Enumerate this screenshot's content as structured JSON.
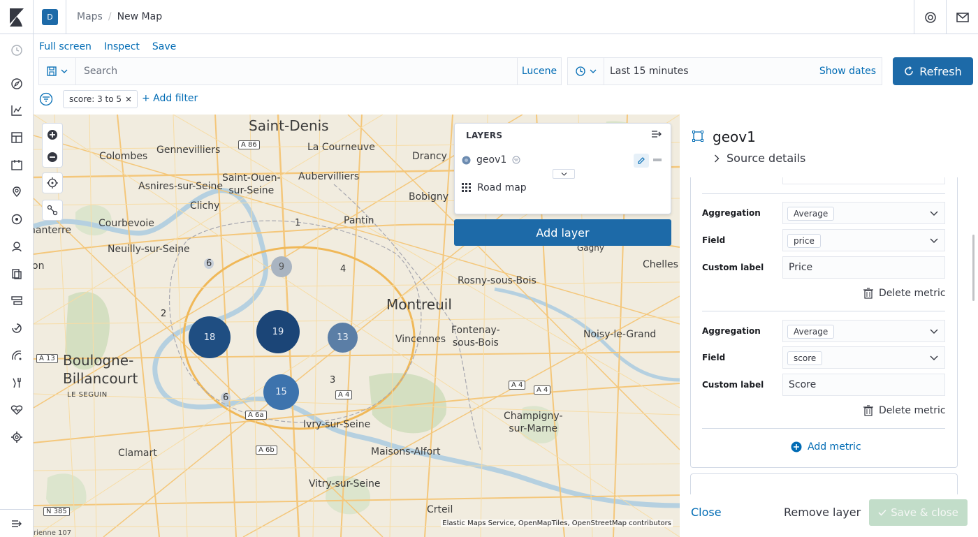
{
  "topnav": {
    "space_initial": "D",
    "breadcrumb": [
      "Maps",
      "New Map"
    ],
    "separator": "/"
  },
  "menu": [
    "Full screen",
    "Inspect",
    "Save"
  ],
  "query": {
    "placeholder": "Search",
    "language": "Lucene"
  },
  "time": {
    "range": "Last 15 minutes",
    "show_dates": "Show dates",
    "refresh": "Refresh"
  },
  "filters": {
    "pills": [
      "score: 3 to 5"
    ],
    "add": "+ Add filter"
  },
  "map": {
    "places": [
      "Saint-Denis",
      "La Courneuve",
      "Colombes",
      "Gennevilliers",
      "Drancy",
      "Saint-Ouen-\nsur-Seine",
      "Aubervilliers",
      "Asnires-sur-Seine",
      "Bobigny",
      "Clichy",
      "Pantin",
      "Courbevoie",
      "Neuilly-sur-Seine",
      "Rosny-sous-Bois",
      "Chelles",
      "Gagny",
      "Montreuil",
      "Fontenay-\nsous-Bois",
      "Vincennes",
      "Noisy-le-Grand",
      "Boulogne-\nBillancourt",
      "LE SEGUIN",
      "Ivry-sur-Seine",
      "Champigny-\nsur-Marne",
      "Clamart",
      "Maisons-Alfort",
      "Vitry-sur-Seine",
      "Crteil",
      "nanterre",
      "on",
      "rienne 107"
    ],
    "roads": [
      "A 86",
      "A 13",
      "A 4",
      "A 4",
      "A 4",
      "A 6a",
      "A 6b",
      "N 385"
    ],
    "clusters": [
      "18",
      "19",
      "13",
      "15",
      "9"
    ],
    "small_counts": [
      "1",
      "6",
      "4",
      "2",
      "3",
      "6"
    ],
    "attribution": "Elastic Maps Service, OpenMapTiles, OpenStreetMap contributors",
    "cluster_colors": {
      "dark": "#1f4e82",
      "mid": "#3d6a9c",
      "light": "#5b86b5",
      "grey": "#a9b4c1"
    }
  },
  "layers": {
    "title": "LAYERS",
    "items": [
      "geov1",
      "Road map"
    ],
    "add_layer": "Add layer"
  },
  "editor": {
    "title": "geov1",
    "source_details": "Source details",
    "metrics": [
      {
        "agg_label": "Aggregation",
        "agg": "Average",
        "field_label": "Field",
        "field": "price",
        "custom_label": "Custom label",
        "label_value": "Price",
        "delete": "Delete metric"
      },
      {
        "agg_label": "Aggregation",
        "agg": "Average",
        "field_label": "Field",
        "field": "score",
        "custom_label": "Custom label",
        "label_value": "Score",
        "delete": "Delete metric"
      }
    ],
    "add_metric": "Add metric",
    "close": "Close",
    "remove": "Remove layer",
    "save_close": "Save & close"
  },
  "colors": {
    "accent": "#1d6aa8",
    "link": "#006bb4",
    "success_disabled": "#c2ddc9"
  }
}
